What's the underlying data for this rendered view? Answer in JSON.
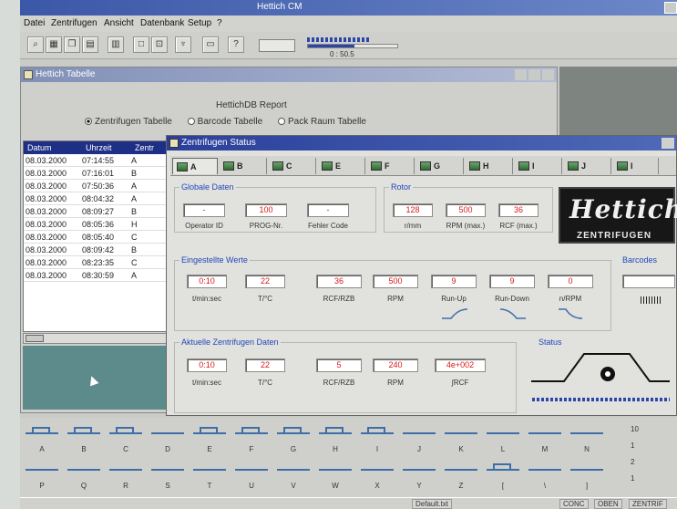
{
  "app": {
    "title": "Hettich CM",
    "menu": [
      "Datei",
      "Zentrifugen",
      "Ansicht",
      "Datenbank",
      "Setup",
      "?"
    ],
    "toolbar_icons": [
      "search-icon",
      "grid-icon",
      "copy-icon",
      "chart-icon",
      "table-icon",
      "window-icon",
      "chair-icon",
      "key-icon",
      "display-icon",
      "help-icon"
    ],
    "speed_text": "0 : 50.5",
    "progress": 0.52,
    "accent": "#2b46a8"
  },
  "report_window": {
    "title": "Hettich Tabelle",
    "report_label": "HettichDB Report",
    "options": [
      {
        "label": "Zentrifugen Tabelle",
        "selected": true
      },
      {
        "label": "Barcode Tabelle",
        "selected": false
      },
      {
        "label": "Pack Raum Tabelle",
        "selected": false
      }
    ],
    "columns": [
      "Datum",
      "Uhrzeit",
      "Zentr"
    ],
    "rows": [
      [
        "08.03.2000",
        "07:14:55",
        "A"
      ],
      [
        "08.03.2000",
        "07:16:01",
        "B"
      ],
      [
        "08.03.2000",
        "07:50:36",
        "A"
      ],
      [
        "08.03.2000",
        "08:04:32",
        "A"
      ],
      [
        "08.03.2000",
        "08:09:27",
        "B"
      ],
      [
        "08.03.2000",
        "08:05:36",
        "H"
      ],
      [
        "08.03.2000",
        "08:05:40",
        "C"
      ],
      [
        "08.03.2000",
        "08:09:42",
        "B"
      ],
      [
        "08.03.2000",
        "08:23:35",
        "C"
      ],
      [
        "08.03.2000",
        "08:30:59",
        "A"
      ]
    ]
  },
  "status_window": {
    "title": "Zentrifugen Status",
    "tabs": [
      "A",
      "B",
      "C",
      "E",
      "F",
      "G",
      "H",
      "I",
      "J",
      "I"
    ],
    "global_group": {
      "label": "Globale Daten",
      "fields": [
        {
          "value": "-",
          "caption": "Operator ID"
        },
        {
          "value": "100",
          "caption": "PROG-Nr."
        },
        {
          "value": "-",
          "caption": "Fehler Code"
        }
      ]
    },
    "rotor_group": {
      "label": "Rotor",
      "fields": [
        {
          "value": "128",
          "caption": "r/mm"
        },
        {
          "value": "500",
          "caption": "RPM (max.)"
        },
        {
          "value": "36",
          "caption": "RCF (max.)"
        }
      ]
    },
    "logo": {
      "name": "Hettich",
      "sub": "ZENTRIFUGEN"
    },
    "set_group": {
      "label": "Eingestellte Werte",
      "fields": [
        {
          "value": "0:10",
          "caption": "t/min:sec"
        },
        {
          "value": "22",
          "caption": "T/°C"
        },
        {
          "value": "36",
          "caption": "RCF/RZB"
        },
        {
          "value": "500",
          "caption": "RPM"
        },
        {
          "value": "9",
          "caption": "Run-Up"
        },
        {
          "value": "9",
          "caption": "Run-Down"
        },
        {
          "value": "0",
          "caption": "n/RPM"
        }
      ]
    },
    "barcode": {
      "label": "Barcodes"
    },
    "current_group": {
      "label": "Aktuelle Zentrifugen Daten",
      "fields": [
        {
          "value": "0:10",
          "caption": "t/min:sec"
        },
        {
          "value": "22",
          "caption": "T/°C"
        },
        {
          "value": "5",
          "caption": "RCF/RZB"
        },
        {
          "value": "240",
          "caption": "RPM"
        },
        {
          "value": "4e+002",
          "caption": "∫RCF"
        }
      ]
    },
    "status": {
      "label": "Status"
    }
  },
  "bottom_row1_labels": [
    "A",
    "B",
    "C",
    "D",
    "E",
    "F",
    "G",
    "H",
    "I",
    "J",
    "K",
    "L",
    "M",
    "N"
  ],
  "bottom_row2_labels": [
    "P",
    "Q",
    "R",
    "S",
    "T",
    "U",
    "V",
    "W",
    "X",
    "Y",
    "Z",
    "[",
    "\\",
    "]"
  ],
  "side_labels": [
    "10",
    "1",
    "2",
    "1"
  ],
  "statusbar": {
    "left": "Default.txt",
    "cells": [
      "CONC",
      "OBEN",
      "ZENTRIF"
    ]
  }
}
